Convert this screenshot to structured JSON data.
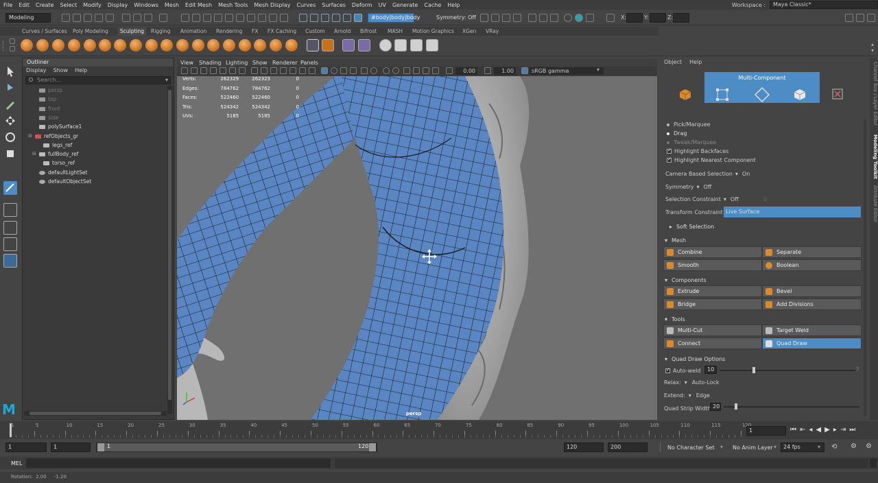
{
  "menubar": {
    "items": [
      "File",
      "Edit",
      "Create",
      "Select",
      "Modify",
      "Display",
      "Windows",
      "Mesh",
      "Edit Mesh",
      "Mesh Tools",
      "Mesh Display",
      "Curves",
      "Surfaces",
      "Deform",
      "UV",
      "Generate",
      "Cache",
      "Help"
    ],
    "workspace_label": "Workspace :",
    "workspace_value": "Maya Classic*"
  },
  "statusline": {
    "mode": "Modeling",
    "object_path": "#body|body|body",
    "symmetry": "Symmetry: Off",
    "x_label": "X:",
    "y_label": "Y:",
    "z_label": "Z:"
  },
  "shelf_tabs": [
    "Curves / Surfaces",
    "Poly Modeling",
    "Sculpting",
    "Rigging",
    "Animation",
    "Rendering",
    "FX",
    "FX Caching",
    "Custom",
    "Arnold",
    "Bifrost",
    "MASH",
    "Motion Graphics",
    "XGen",
    "VRay"
  ],
  "shelf_active_tab": "Sculpting",
  "outliner": {
    "title": "Outliner",
    "menu": [
      "Display",
      "Show",
      "Help"
    ],
    "search_placeholder": "Search...",
    "items": [
      {
        "label": "persp",
        "indent": 1,
        "dim": true
      },
      {
        "label": "top",
        "indent": 1,
        "dim": true
      },
      {
        "label": "front",
        "indent": 1,
        "dim": true
      },
      {
        "label": "side",
        "indent": 1,
        "dim": true
      },
      {
        "label": "polySurface1",
        "indent": 1,
        "dim": false
      },
      {
        "label": "refObjects_gr",
        "indent": 0,
        "dim": false
      },
      {
        "label": "legs_ref",
        "indent": 2,
        "dim": false
      },
      {
        "label": "fullBody_ref",
        "indent": 1,
        "dim": false
      },
      {
        "label": "torso_ref",
        "indent": 2,
        "dim": false
      },
      {
        "label": "defaultLightSet",
        "indent": 1,
        "dim": false
      },
      {
        "label": "defaultObjectSet",
        "indent": 1,
        "dim": false
      }
    ]
  },
  "viewport": {
    "menu": [
      "View",
      "Shading",
      "Lighting",
      "Show",
      "Renderer",
      "Panels"
    ],
    "exposure": "0.00",
    "gamma": "1.00",
    "color_space": "sRGB gamma",
    "camera_label": "persp",
    "hud": [
      {
        "k": "Verts:",
        "a": "262329",
        "b": "262323",
        "c": "0"
      },
      {
        "k": "Edges:",
        "a": "784762",
        "b": "784762",
        "c": "0"
      },
      {
        "k": "Faces:",
        "a": "522460",
        "b": "522460",
        "c": "0"
      },
      {
        "k": "Tris:",
        "a": "524342",
        "b": "524342",
        "c": "0"
      },
      {
        "k": "UVs:",
        "a": "5185",
        "b": "5185",
        "c": "0"
      }
    ]
  },
  "modeling_toolkit": {
    "menu": [
      "Object",
      "Help"
    ],
    "mode": "Multi-Component",
    "pick": "Pick/Marquee",
    "drag": "Drag",
    "tweak": "Tweak/Marquee",
    "backfaces": "Highlight Backfaces",
    "nearest": "Highlight Nearest Component",
    "camera_sel_label": "Camera Based Selection",
    "camera_sel_value": "On",
    "symmetry_label": "Symmetry",
    "symmetry_value": "Off",
    "sel_constraint_label": "Selection Constraint",
    "sel_constraint_value": "Off",
    "sel_constraint_num": "0",
    "transform_label": "Transform Constraint",
    "transform_value": "Live Surface",
    "soft_selection": "Soft Selection",
    "mesh_header": "Mesh",
    "combine": "Combine",
    "separate": "Separate",
    "smooth": "Smooth",
    "boolean": "Boolean",
    "components_header": "Components",
    "extrude": "Extrude",
    "bevel": "Bevel",
    "bridge": "Bridge",
    "add_divisions": "Add Divisions",
    "tools_header": "Tools",
    "multicut": "Multi-Cut",
    "target_weld": "Target Weld",
    "connect": "Connect",
    "quad_draw": "Quad Draw",
    "qd_header": "Quad Draw Options",
    "autoweld": "Auto-weld",
    "autoweld_value": "10",
    "qmark": "?",
    "relax_label": "Relax:",
    "relax_value": "Auto-Lock",
    "extend_label": "Extend:",
    "extend_value": "Edge",
    "strip_label": "Quad Strip Width:",
    "strip_value": "20"
  },
  "side_tabs": [
    "Channel Box / Layer Editor",
    "Modeling Toolkit",
    "Attribute Editor"
  ],
  "timeline": {
    "ticks": [
      "1",
      "5",
      "10",
      "15",
      "20",
      "25",
      "30",
      "35",
      "40",
      "45",
      "50",
      "55",
      "60",
      "65",
      "70",
      "75",
      "80",
      "85",
      "90",
      "95",
      "100",
      "105",
      "110",
      "115",
      "120"
    ],
    "current": "1"
  },
  "range": {
    "start": "1",
    "start2": "1",
    "slider_start": "1",
    "slider_end": "120",
    "end": "120",
    "end2": "200",
    "char_set": "No Character Set",
    "anim_layer": "No Anim Layer",
    "fps": "24 fps"
  },
  "cmd": {
    "label": "MEL"
  },
  "help": {
    "text": "Rotation:  2.00     -1.20"
  },
  "colors": {
    "selection_blue": "#4d8cc5",
    "mesh_blue": "#5b86c4",
    "icon_orange": "#d98a2f"
  }
}
